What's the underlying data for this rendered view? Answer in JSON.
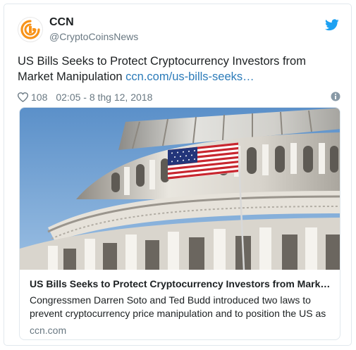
{
  "account": {
    "display_name": "CCN",
    "handle": "@CryptoCoinsNews"
  },
  "tweet": {
    "text": "US Bills Seeks to Protect Cryptocurrency Investors from Market Manipulation",
    "link_text": "ccn.com/us-bills-seeks…",
    "likes": "108",
    "timestamp": "02:05 - 8 thg 12, 2018"
  },
  "card": {
    "title": "US Bills Seeks to Protect Cryptocurrency Investors from Mark…",
    "description": "Congressmen Darren Soto and Ted Budd introduced two laws to prevent cryptocurrency price manipulation and to position the US as",
    "domain": "ccn.com"
  },
  "icons": {
    "avatar": "ccn-logo-icon",
    "brand": "twitter-bird-icon",
    "like": "heart-icon",
    "info": "info-icon"
  },
  "colors": {
    "link": "#2b7bb9",
    "twitter_blue": "#1da1f2",
    "ccn_orange": "#f7931a",
    "muted": "#697882"
  }
}
